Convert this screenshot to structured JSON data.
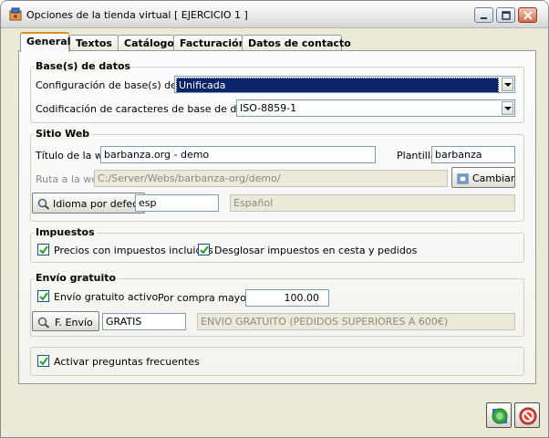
{
  "window": {
    "title": "Opciones de la tienda virtual [ EJERCICIO 1 ]"
  },
  "tabs": [
    "General",
    "Textos",
    "Catálogo",
    "Facturación",
    "Datos de contacto"
  ],
  "database": {
    "title": "Base(s) de datos",
    "config_label": "Configuración de base(s) de datos",
    "config_value": "Unificada",
    "encoding_label": "Codificación de caracteres de base de datos y web",
    "encoding_value": "ISO-8859-1"
  },
  "website": {
    "title": "Sitio Web",
    "web_title_label": "Título de la web",
    "web_title_value": "barbanza.org - demo",
    "template_label": "Plantilla",
    "template_value": "barbanza",
    "path_label": "Ruta a la web",
    "path_value": "C:/Server/Webs/barbanza-org/demo/",
    "change_button": "Cambiar",
    "language_button": "Idioma por defecto",
    "language_code": "esp",
    "language_name": "Español"
  },
  "taxes": {
    "title": "Impuestos",
    "prices_with_tax_label": "Precios con impuestos incluidos",
    "prices_with_tax_checked": true,
    "break_down_label": "Desglosar impuestos en cesta y pedidos",
    "break_down_checked": true
  },
  "free_shipping": {
    "title": "Envío gratuito",
    "active_label": "Envío gratuito activo",
    "active_checked": true,
    "threshold_label": "Por compra mayor de",
    "threshold_value": "100.00",
    "shipping_button": "F. Envío",
    "shipping_code": "GRATIS",
    "shipping_description": "ENVIO GRATUITO (PEDIDOS SUPERIORES A 600€)"
  },
  "faq": {
    "label": "Activar preguntas frecuentes",
    "checked": true
  }
}
